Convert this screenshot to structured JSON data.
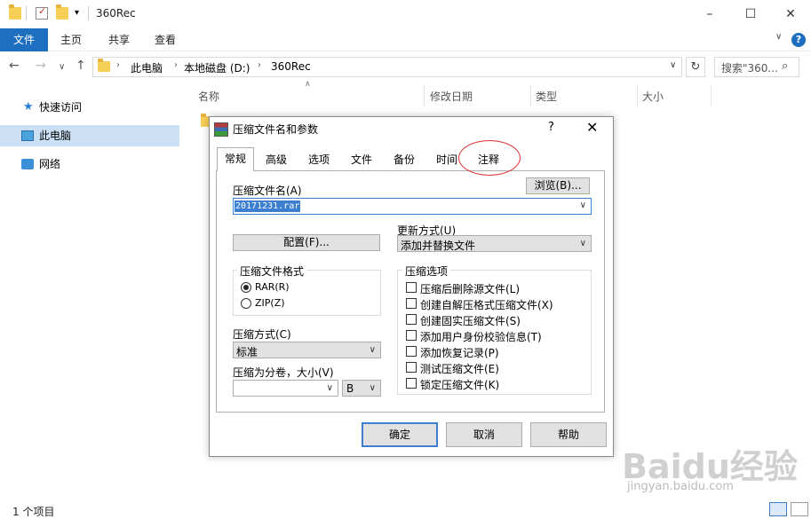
{
  "window": {
    "title": "360Rec"
  },
  "ribbon": {
    "tabs": [
      "文件",
      "主页",
      "共享",
      "查看"
    ]
  },
  "address": {
    "crumbs": [
      "此电脑",
      "本地磁盘 (D:)",
      "360Rec"
    ],
    "search_placeholder": "搜索\"360..."
  },
  "nav": {
    "items": [
      "快速访问",
      "此电脑",
      "网络"
    ]
  },
  "columns": [
    "名称",
    "修改日期",
    "类型",
    "大小"
  ],
  "status": "1 个项目",
  "dialog": {
    "title": "压缩文件名和参数",
    "help": "?",
    "close": "✕",
    "tabs": [
      "常规",
      "高级",
      "选项",
      "文件",
      "备份",
      "时间",
      "注释"
    ],
    "filename_label": "压缩文件名(A)",
    "browse_label": "浏览(B)...",
    "filename_value": "20171231.rar",
    "update_label": "更新方式(U)",
    "update_value": "添加并替换文件",
    "config_label": "配置(F)...",
    "format_group": "压缩文件格式",
    "formats": [
      "RAR(R)",
      "ZIP(Z)"
    ],
    "method_label": "压缩方式(C)",
    "method_value": "标准",
    "split_label": "压缩为分卷，大小(V)",
    "split_unit": "B",
    "options_group": "压缩选项",
    "options": [
      "压缩后删除源文件(L)",
      "创建自解压格式压缩文件(X)",
      "创建固实压缩文件(S)",
      "添加用户身份校验信息(T)",
      "添加恢复记录(P)",
      "测试压缩文件(E)",
      "锁定压缩文件(K)"
    ],
    "buttons": {
      "ok": "确定",
      "cancel": "取消",
      "help": "帮助"
    }
  },
  "watermark": {
    "brand": "Baidu经验",
    "url": "jingyan.baidu.com"
  },
  "colors": {
    "accent": "#1e6fbf",
    "focus": "#3c7fd1",
    "annotation": "#e03030"
  }
}
